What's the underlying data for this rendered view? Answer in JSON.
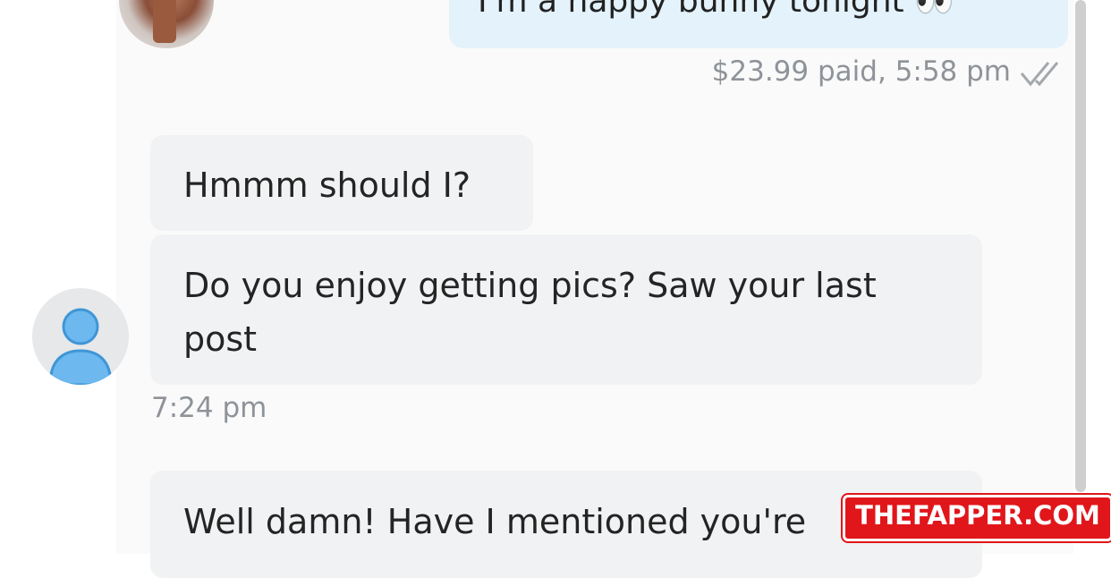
{
  "messages": {
    "outgoing": {
      "text": "I'm a happy bunny tonight 👀",
      "meta": "$23.99 paid,  5:58 pm",
      "status_icon": "double-check-icon"
    },
    "incoming": [
      {
        "text": "Hmmm should I?"
      },
      {
        "text": "Do you enjoy getting pics? Saw your last post"
      }
    ],
    "incoming_time": "7:24 pm",
    "incoming_next": {
      "text": "Well damn! Have I mentioned you're"
    }
  },
  "avatars": {
    "creator": "profile-photo-avatar",
    "user": "default-user-avatar"
  },
  "watermark": {
    "text": "THEFAPPER.COM"
  },
  "colors": {
    "outgoing_bubble": "#e3f2fb",
    "incoming_bubble": "#f1f2f3",
    "meta_text": "#8e9399",
    "avatar_blue": "#6cb8ef",
    "watermark_red": "#e0161b"
  }
}
